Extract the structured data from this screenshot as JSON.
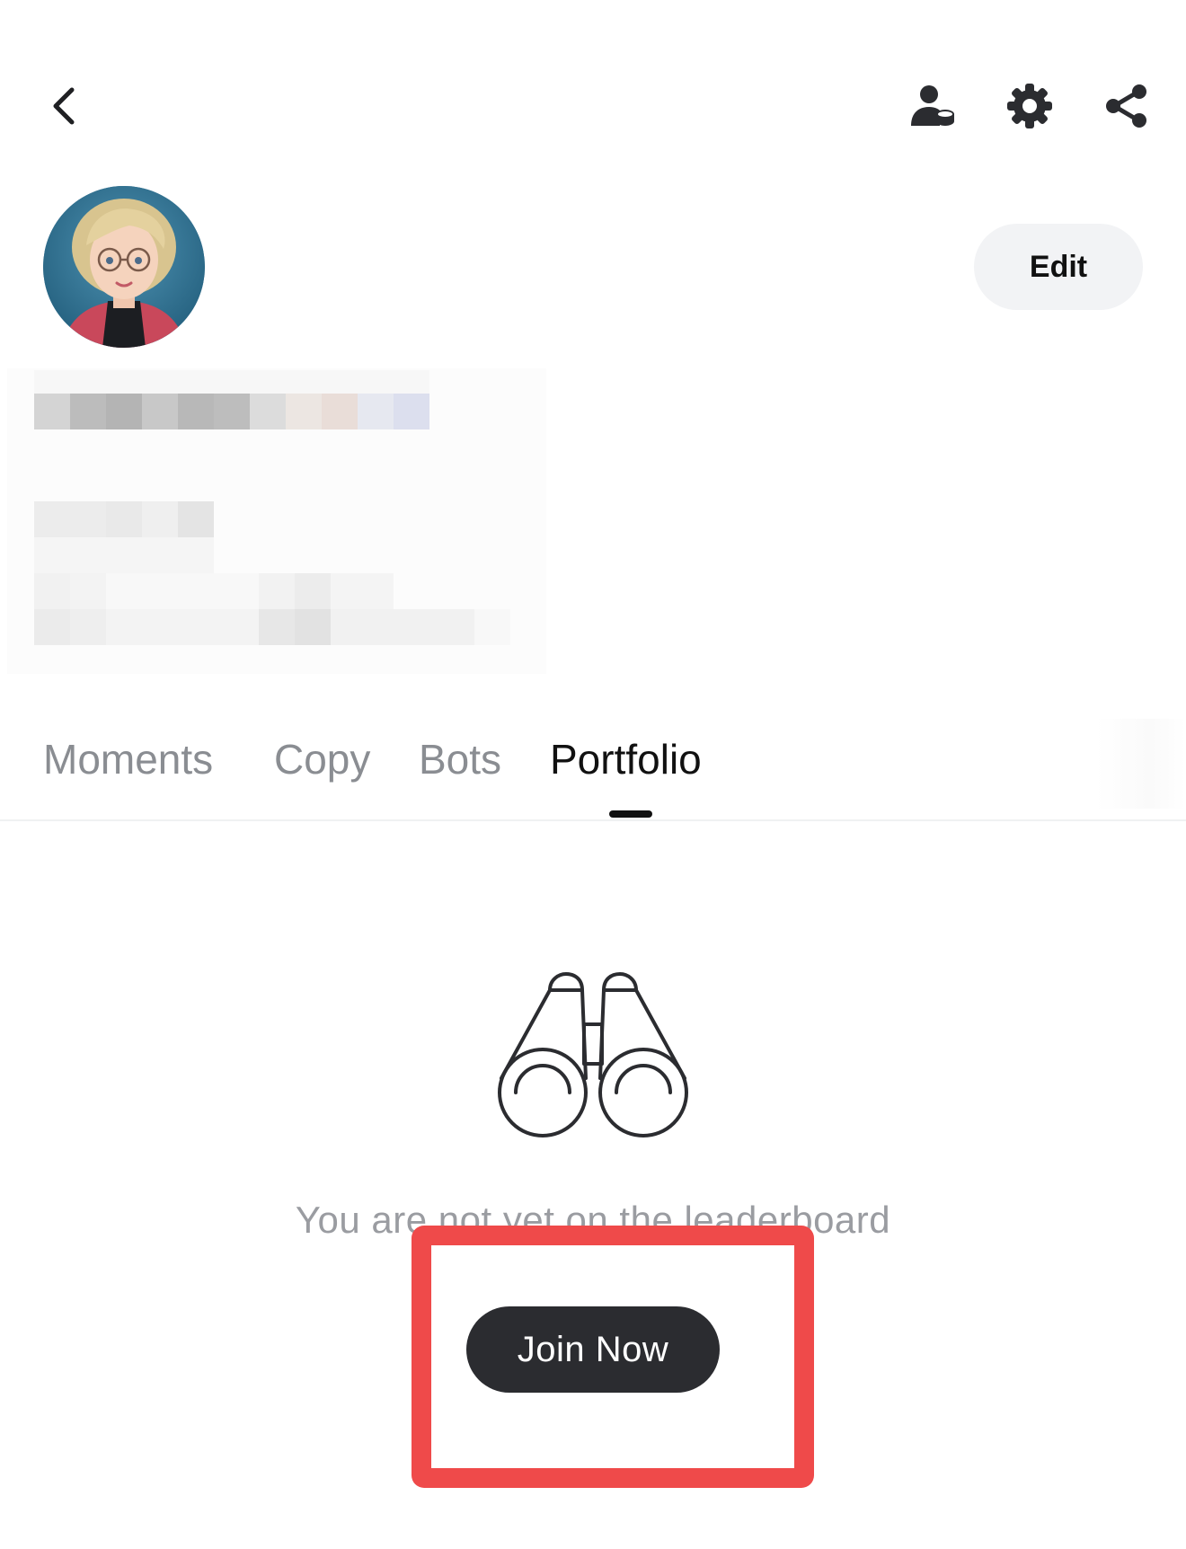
{
  "header": {
    "back_icon": "chevron-left-icon",
    "actions": [
      "user-coin-icon",
      "gear-icon",
      "share-icon"
    ]
  },
  "profile": {
    "edit_label": "Edit"
  },
  "tabs": [
    {
      "label": "Moments",
      "active": false
    },
    {
      "label": "Copy",
      "active": false
    },
    {
      "label": "Bots",
      "active": false
    },
    {
      "label": "Portfolio",
      "active": true
    }
  ],
  "empty_state": {
    "icon": "binoculars-icon",
    "message": "You are not yet on the leaderboard",
    "button_label": "Join Now"
  },
  "colors": {
    "highlight": "#ef4a4a",
    "button_dark": "#2b2c30",
    "muted_text": "#9a9ca1"
  }
}
